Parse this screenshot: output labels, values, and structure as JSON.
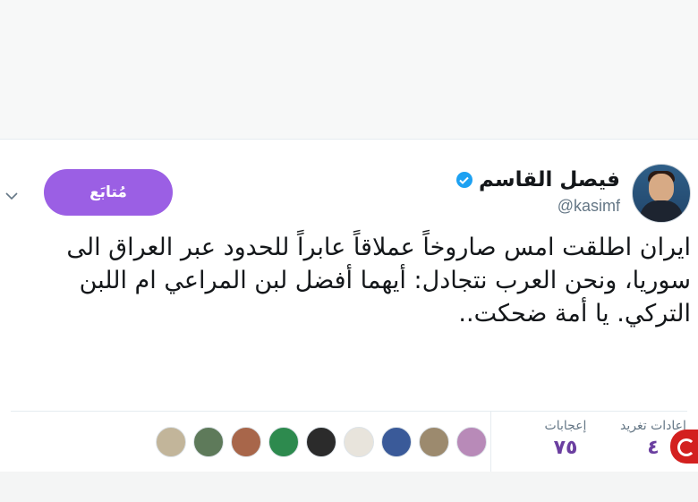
{
  "profile": {
    "display_name": "فيصل القاسم",
    "handle": "@kasimf",
    "verified": true
  },
  "follow_button": {
    "label": "مُتابَع",
    "color": "#9b5fe4"
  },
  "tweet": {
    "text": "ايران اطلقت امس صاروخاً عملاقاً عابراً للحدود عبر العراق الى سوريا، ونحن العرب نتجادل: أيهما أفضل لبن المراعي ام اللبن التركي. يا أمة ضحكت.."
  },
  "stats": {
    "retweets": {
      "label": "إعادات تغريد",
      "value": "٤"
    },
    "likes": {
      "label": "إعجابات",
      "value": "٧٥"
    }
  },
  "likers": [
    {
      "color": "#b88ab8"
    },
    {
      "color": "#9c8a6e"
    },
    {
      "color": "#3a5a99"
    },
    {
      "color": "#e8e4dc"
    },
    {
      "color": "#2b2b2b"
    },
    {
      "color": "#2d8a4e"
    },
    {
      "color": "#a8664a"
    },
    {
      "color": "#5e7a5a"
    },
    {
      "color": "#c2b59a"
    }
  ],
  "icons": [
    "verified-icon",
    "chevron-down-icon"
  ]
}
